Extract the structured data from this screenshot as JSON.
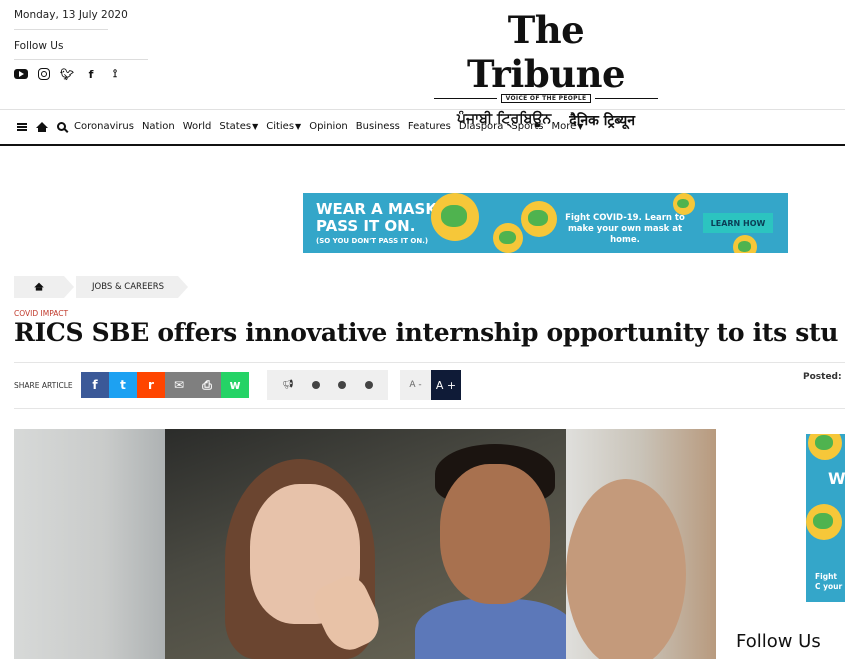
{
  "header": {
    "date": "Monday, 13 July 2020",
    "follow_label": "Follow Us",
    "social_icons": [
      "youtube-icon",
      "instagram-icon",
      "twitter-icon",
      "facebook-icon",
      "rss-icon"
    ],
    "logo": "The Tribune",
    "tagline": "VOICE OF THE PEOPLE",
    "sister_punjabi": "ਪੰਜਾਬੀ ਟ੍ਰਿਬਿਊਨ",
    "sister_hindi": "दैनिक ट्रिब्यून"
  },
  "nav": {
    "items": [
      "Coronavirus",
      "Nation",
      "World",
      "States",
      "Cities",
      "Opinion",
      "Business",
      "Features",
      "Diaspora",
      "Sports",
      "More"
    ],
    "dropdown_items": [
      "States",
      "Cities",
      "More"
    ]
  },
  "ad": {
    "headline_line1": "WEAR A MASK.",
    "headline_line2": "PASS IT ON.",
    "subline": "(SO YOU DON'T PASS IT ON.)",
    "middle_text": "Fight COVID-19. Learn to make your own mask at home.",
    "button": "LEARN HOW",
    "bg_color": "#34a6c9"
  },
  "article": {
    "breadcrumb_category": "JOBS & CAREERS",
    "kicker": "COVID IMPACT",
    "headline": "RICS SBE offers innovative internship opportunity to its students",
    "share_label": "SHARE ARTICLE",
    "share_buttons": [
      {
        "name": "facebook-share-button",
        "glyph": "f",
        "color": "#3b5998"
      },
      {
        "name": "twitter-share-button",
        "glyph": "t",
        "color": "#1da1f2"
      },
      {
        "name": "reddit-share-button",
        "glyph": "r",
        "color": "#ff4500"
      },
      {
        "name": "email-share-button",
        "glyph": "✉",
        "color": "#7f7f7f"
      },
      {
        "name": "print-share-button",
        "glyph": "⎙",
        "color": "#7f7f7f"
      },
      {
        "name": "whatsapp-share-button",
        "glyph": "w",
        "color": "#25d366"
      }
    ],
    "font_decrease": "A -",
    "font_increase": "A +",
    "posted_label": "Posted:"
  },
  "sidebar": {
    "follow_label": "Follow Us",
    "ad_letter": "W",
    "ad_text": "Fight C your"
  }
}
